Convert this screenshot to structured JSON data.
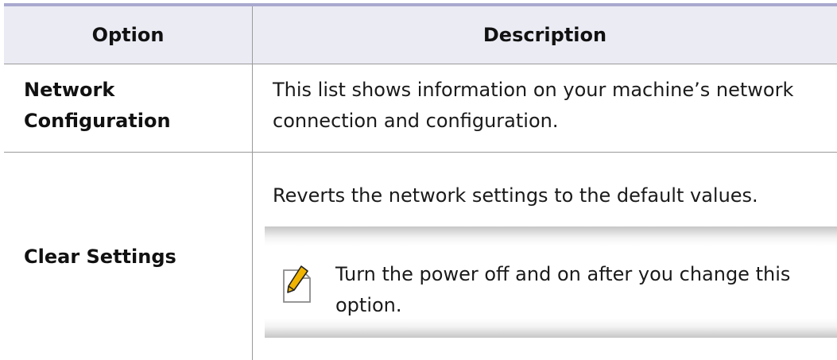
{
  "table": {
    "headers": {
      "option": "Option",
      "description": "Description"
    },
    "rows": [
      {
        "option_line1": "Network",
        "option_line2": "Configuration",
        "description_line1": "This list shows information on your machine’s network",
        "description_line2": "connection and configuration."
      },
      {
        "option": "Clear Settings",
        "description": "Reverts the network settings to the default values.",
        "note": {
          "icon": "note-pencil-icon",
          "line1": "Turn the power off and on after you change this",
          "line2": "option."
        }
      }
    ]
  },
  "colors": {
    "header_background": "#ebebf4",
    "top_rule": "#a9a9cf",
    "note_pencil": "#f0b400"
  }
}
